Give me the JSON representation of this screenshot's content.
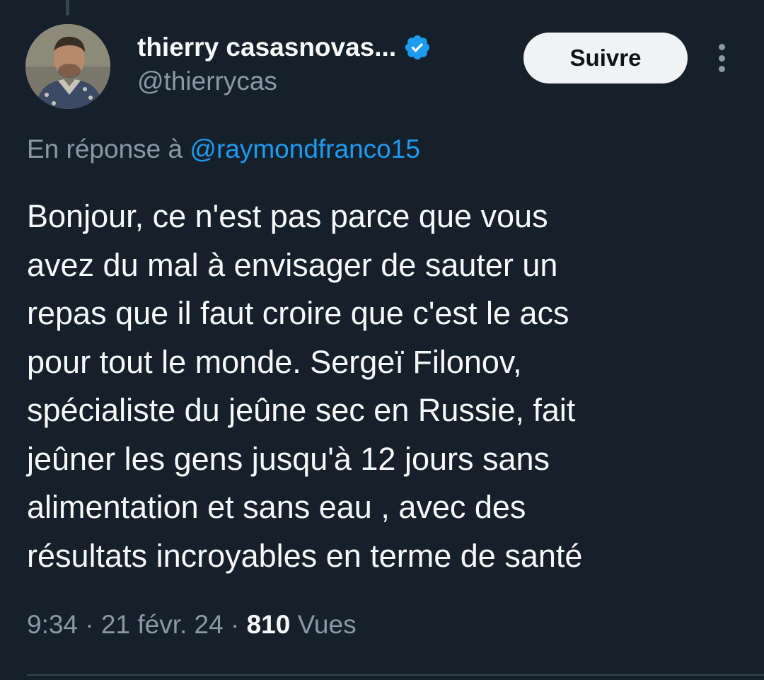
{
  "tweet": {
    "author": {
      "display_name": "thierry casasnovas...",
      "handle": "@thierrycas",
      "verified": true
    },
    "follow_label": "Suivre",
    "reply_to": {
      "prefix": "En réponse à ",
      "mention": "@raymondfranco15"
    },
    "text": "Bonjour, ce n'est pas parce que vous\navez du mal à envisager de sauter un\nrepas que il faut croire que c'est le acs\npour tout le monde. Sergeï Filonov,\nspécialiste du jeûne sec en Russie, fait\njeûner les gens jusqu'à 12 jours sans\nalimentation et sans eau , avec des\nrésultats incroyables en terme de santé",
    "time": "9:34",
    "separator": " · ",
    "date": "21 févr. 24",
    "views_count": "810",
    "views_label": " Vues"
  },
  "colors": {
    "background": "#15202b",
    "text_primary": "#f7f9f9",
    "text_secondary": "#8b98a5",
    "accent": "#1d9bf0",
    "button_bg": "#eff3f4"
  },
  "icons": {
    "verified": "verified-badge-icon",
    "more": "more-options-icon"
  }
}
